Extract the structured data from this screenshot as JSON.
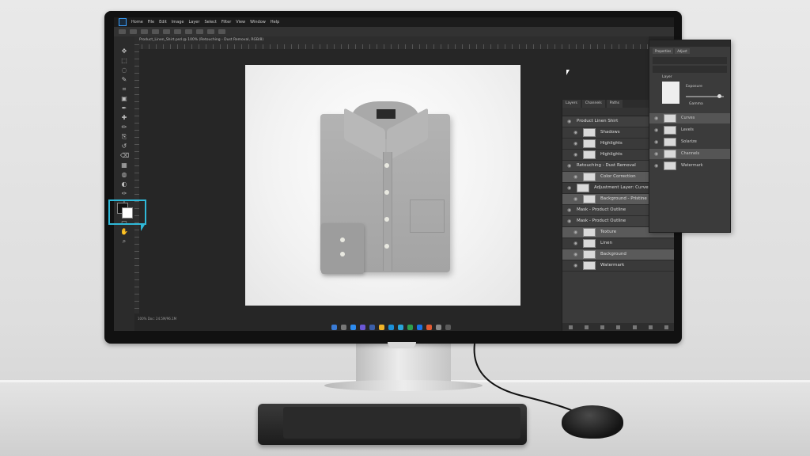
{
  "menubar": {
    "items": [
      "Home",
      "File",
      "Edit",
      "Image",
      "Layer",
      "Select",
      "Filter",
      "View",
      "Window",
      "Help"
    ]
  },
  "document_tab": "Product_Linen_Shirt.psd @ 100% (Retouching - Dust Removal, RGB/8)",
  "status_text": "100%     Doc: 24.5M/96.1M",
  "tools": [
    "move-icon",
    "marquee-icon",
    "lasso-icon",
    "quick-select-icon",
    "crop-icon",
    "frame-icon",
    "eyedropper-icon",
    "healing-icon",
    "brush-icon",
    "stamp-icon",
    "history-brush-icon",
    "eraser-icon",
    "gradient-icon",
    "blur-icon",
    "dodge-icon",
    "pen-icon",
    "type-icon",
    "path-select-icon",
    "shape-icon",
    "hand-icon",
    "zoom-icon"
  ],
  "layers_panel": {
    "tabs": [
      "Layers",
      "Channels",
      "Paths"
    ],
    "rows": [
      {
        "label": "Product Linen Shirt",
        "indent": 0,
        "group": true
      },
      {
        "label": "Shadows",
        "indent": 1
      },
      {
        "label": "Highlights",
        "indent": 1
      },
      {
        "label": "Highlights",
        "indent": 1
      },
      {
        "label": "Retouching - Dust Removal",
        "indent": 0,
        "group": true
      },
      {
        "label": "Color Correction",
        "indent": 1,
        "selected": true
      },
      {
        "label": "Adjustment Layer: Curves",
        "indent": 0
      },
      {
        "label": "Background - Pristine Detail",
        "indent": 1,
        "selected": true
      },
      {
        "label": "Mask - Product Outline",
        "indent": 0,
        "group": true
      },
      {
        "label": "Mask - Product Outline",
        "indent": 0,
        "group": true
      },
      {
        "label": "Texture",
        "indent": 1,
        "selected": true
      },
      {
        "label": "Linen",
        "indent": 1
      },
      {
        "label": "Background",
        "indent": 1,
        "selected": true
      },
      {
        "label": "Watermark",
        "indent": 1
      }
    ]
  },
  "properties_panel": {
    "tabs": [
      "Properties",
      "Adjust"
    ],
    "label_top": "Layer",
    "exposure_label": "Exposure",
    "value_label": "Gamma",
    "rows": [
      {
        "label": "Curves",
        "selected": true
      },
      {
        "label": "Levels"
      },
      {
        "label": "Solarize",
        "selected": false
      },
      {
        "label": "Channels",
        "selected": true
      },
      {
        "label": "Watermark"
      }
    ]
  },
  "colors": {
    "highlight": "#2fb8d8",
    "ui_dark": "#262626",
    "panel": "#3a3a3a"
  }
}
